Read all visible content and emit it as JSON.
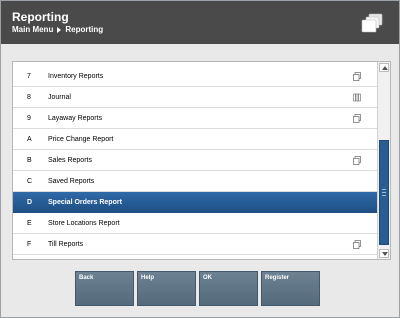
{
  "header": {
    "title": "Reporting",
    "breadcrumb": [
      "Main Menu",
      "Reporting"
    ],
    "app_icon": "folders-icon"
  },
  "menu": {
    "items": [
      {
        "key": "7",
        "label": "Inventory Reports",
        "icon": "folder-icon",
        "selected": false
      },
      {
        "key": "8",
        "label": "Journal",
        "icon": "journal-icon",
        "selected": false
      },
      {
        "key": "9",
        "label": "Layaway Reports",
        "icon": "folder-icon",
        "selected": false
      },
      {
        "key": "A",
        "label": "Price Change Report",
        "icon": "",
        "selected": false
      },
      {
        "key": "B",
        "label": "Sales Reports",
        "icon": "folder-icon",
        "selected": false
      },
      {
        "key": "C",
        "label": "Saved Reports",
        "icon": "",
        "selected": false
      },
      {
        "key": "D",
        "label": "Special Orders Report",
        "icon": "",
        "selected": true
      },
      {
        "key": "E",
        "label": "Store Locations Report",
        "icon": "",
        "selected": false
      },
      {
        "key": "F",
        "label": "Till Reports",
        "icon": "folder-icon",
        "selected": false
      }
    ]
  },
  "buttons": {
    "back": "Back",
    "help": "Help",
    "ok": "OK",
    "register": "Register"
  },
  "colors": {
    "header_bg": "#4a4a4a",
    "selected_row": "#2f6aa8",
    "button_bg": "#617686"
  }
}
